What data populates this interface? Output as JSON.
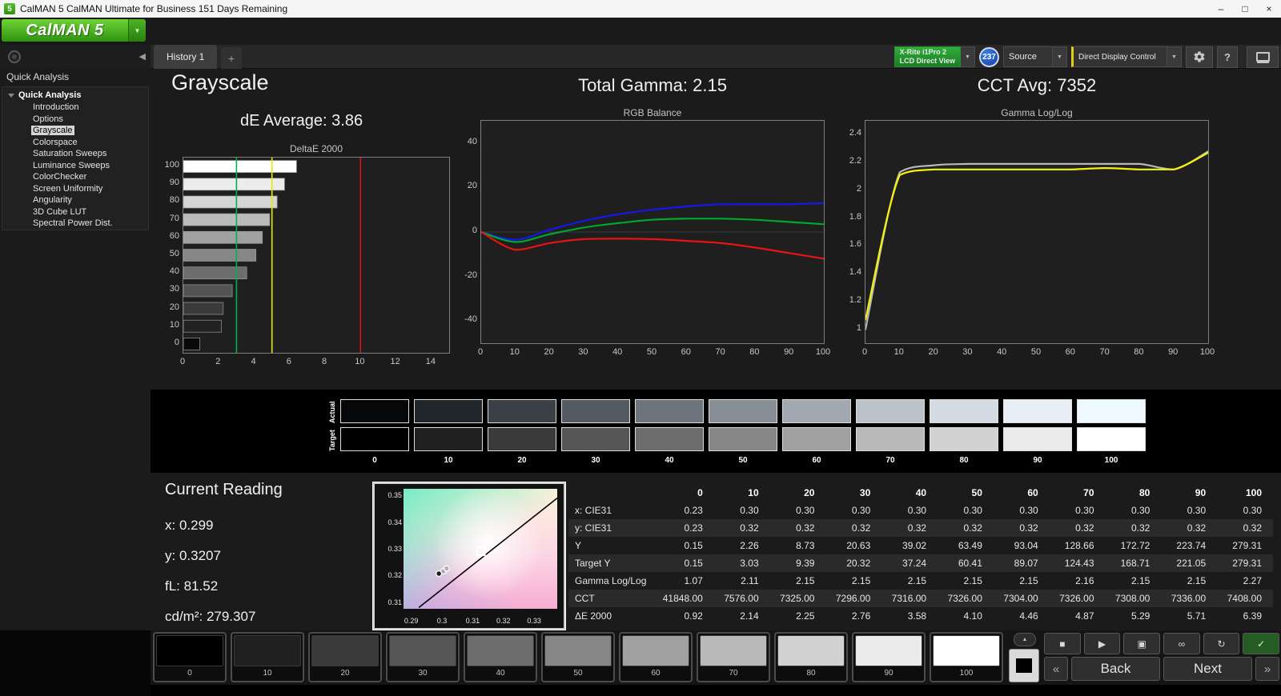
{
  "window": {
    "icon_text": "5",
    "title": "CalMAN 5 CalMAN Ultimate for Business 151 Days Remaining",
    "logo_text": "CalMAN 5"
  },
  "icons": {
    "dropdown": "▼",
    "collapse_left": "◀",
    "chevron_up": "▲",
    "back_chevrons": "«",
    "next_chevrons": "»",
    "help": "?",
    "add_tab": "+",
    "minimize": "–",
    "maximize": "□",
    "close": "×"
  },
  "toolbar": {
    "history_tab": "History 1",
    "meter_line1": "X-Rite i1Pro 2",
    "meter_line2": "LCD Direct View",
    "meter_badge": "237",
    "source_label": "Source",
    "display_control_label": "Direct Display Control"
  },
  "sidebar": {
    "header": "Quick Analysis",
    "tree_root": "Quick Analysis",
    "selected_item": "Grayscale",
    "items": [
      "Introduction",
      "Options",
      "Grayscale",
      "Colorspace",
      "Saturation Sweeps",
      "Luminance Sweeps",
      "ColorChecker",
      "Screen Uniformity",
      "Angularity",
      "3D Cube LUT",
      "Spectral Power Dist."
    ]
  },
  "header": {
    "title": "Grayscale",
    "de_average": "dE Average: 3.86",
    "total_gamma": "Total Gamma: 2.15",
    "cct_avg": "CCT Avg: 7352"
  },
  "chart_data": [
    {
      "id": "deltae",
      "type": "bar",
      "title": "DeltaE 2000",
      "orientation": "horizontal",
      "categories": [
        "100",
        "90",
        "80",
        "70",
        "60",
        "50",
        "40",
        "30",
        "20",
        "10",
        "0"
      ],
      "values": [
        6.39,
        5.71,
        5.29,
        4.87,
        4.46,
        4.1,
        3.58,
        2.76,
        2.25,
        2.14,
        0.92
      ],
      "bar_colors": [
        "#ffffff",
        "#ececec",
        "#d5d5d5",
        "#bbbbbb",
        "#a1a1a1",
        "#878787",
        "#6d6d6d",
        "#535353",
        "#3a3a3a",
        "#222222",
        "#0a0a0a"
      ],
      "xlim": [
        0,
        15
      ],
      "xticks": [
        0,
        2,
        4,
        6,
        8,
        10,
        12,
        14
      ],
      "reference_lines": [
        {
          "value": 3,
          "color": "#00b050"
        },
        {
          "value": 5,
          "color": "#e8e800"
        },
        {
          "value": 10,
          "color": "#e01010"
        }
      ]
    },
    {
      "id": "rgb",
      "type": "line",
      "title": "RGB Balance",
      "x": [
        0,
        10,
        20,
        30,
        40,
        50,
        60,
        70,
        80,
        90,
        100
      ],
      "ylim": [
        -50,
        50
      ],
      "yticks": [
        40,
        20,
        0,
        -20,
        -40
      ],
      "xticks": [
        0,
        10,
        20,
        30,
        40,
        50,
        60,
        70,
        80,
        90,
        100
      ],
      "zero_line": true,
      "series": [
        {
          "name": "Blue",
          "color": "#1616ee",
          "values": [
            0,
            -3.5,
            1,
            5,
            8,
            10,
            11.5,
            12.5,
            12.5,
            12.5,
            13
          ]
        },
        {
          "name": "Green",
          "color": "#00a82d",
          "values": [
            0,
            -4.5,
            -1,
            2,
            4,
            5.5,
            6,
            6,
            5.5,
            4.5,
            3.5
          ]
        },
        {
          "name": "Red",
          "color": "#e81414",
          "values": [
            0,
            -8,
            -5,
            -3.2,
            -3,
            -3.2,
            -4,
            -5,
            -7,
            -9.5,
            -12
          ]
        }
      ]
    },
    {
      "id": "gamma",
      "type": "line",
      "title": "Gamma Log/Log",
      "x": [
        0,
        10,
        20,
        30,
        40,
        50,
        60,
        70,
        80,
        90,
        100
      ],
      "ylim": [
        0.9,
        2.5
      ],
      "yticks": [
        2.4,
        2.2,
        2,
        1.8,
        1.6,
        1.4,
        1.2,
        1
      ],
      "xticks": [
        0,
        10,
        20,
        30,
        40,
        50,
        60,
        70,
        80,
        90,
        100
      ],
      "zero_line": false,
      "series": [
        {
          "name": "Target",
          "color": "#b8b8b8",
          "values": [
            1.0,
            2.13,
            2.18,
            2.19,
            2.19,
            2.19,
            2.19,
            2.19,
            2.19,
            2.15,
            2.28
          ]
        },
        {
          "name": "Measured",
          "color": "#f2f20a",
          "values": [
            1.07,
            2.11,
            2.15,
            2.15,
            2.15,
            2.15,
            2.15,
            2.16,
            2.15,
            2.15,
            2.27
          ]
        }
      ]
    },
    {
      "id": "cie",
      "type": "scatter",
      "title": "CIE Chart",
      "xlim": [
        0.2875,
        0.3375
      ],
      "ylim": [
        0.3075,
        0.3525
      ],
      "xticks": [
        0.29,
        0.3,
        0.31,
        0.32,
        0.33
      ],
      "yticks": [
        0.35,
        0.34,
        0.33,
        0.32,
        0.31
      ],
      "locus_line": [
        [
          0.2925,
          0.308
        ],
        [
          0.3375,
          0.349
        ]
      ],
      "target_point": {
        "x": 0.3127,
        "y": 0.329
      },
      "points": [
        {
          "x": 0.299,
          "y": 0.3207,
          "style": "filled"
        },
        {
          "x": 0.3005,
          "y": 0.3216,
          "style": "open"
        },
        {
          "x": 0.3015,
          "y": 0.3226,
          "style": "open"
        }
      ]
    }
  ],
  "swatches": {
    "row_labels": [
      "Actual",
      "Target"
    ],
    "levels": [
      "0",
      "10",
      "20",
      "30",
      "40",
      "50",
      "60",
      "70",
      "80",
      "90",
      "100"
    ],
    "actual_colors": [
      "#050708",
      "#21262b",
      "#3a4046",
      "#535a61",
      "#6d747b",
      "#878e95",
      "#a1a8af",
      "#bbc2c9",
      "#d4dbe2",
      "#e7eef5",
      "#eef8ff"
    ],
    "target_colors": [
      "#000000",
      "#202020",
      "#3a3a3a",
      "#555555",
      "#6d6d6d",
      "#868686",
      "#a0a0a0",
      "#b9b9b9",
      "#d2d2d2",
      "#ebebeb",
      "#ffffff"
    ]
  },
  "current_reading": {
    "title": "Current Reading",
    "x": "x: 0.299",
    "y": "y: 0.3207",
    "fl": "fL: 81.52",
    "cdm2": "cd/m²: 279.307"
  },
  "table": {
    "columns": [
      "",
      "0",
      "10",
      "20",
      "30",
      "40",
      "50",
      "60",
      "70",
      "80",
      "90",
      "100"
    ],
    "rows": [
      {
        "label": "x: CIE31",
        "values": [
          "0.23",
          "0.30",
          "0.30",
          "0.30",
          "0.30",
          "0.30",
          "0.30",
          "0.30",
          "0.30",
          "0.30",
          "0.30"
        ]
      },
      {
        "label": "y: CIE31",
        "values": [
          "0.23",
          "0.32",
          "0.32",
          "0.32",
          "0.32",
          "0.32",
          "0.32",
          "0.32",
          "0.32",
          "0.32",
          "0.32"
        ]
      },
      {
        "label": "Y",
        "values": [
          "0.15",
          "2.26",
          "8.73",
          "20.63",
          "39.02",
          "63.49",
          "93.04",
          "128.66",
          "172.72",
          "223.74",
          "279.31"
        ]
      },
      {
        "label": "Target Y",
        "values": [
          "0.15",
          "3.03",
          "9.39",
          "20.32",
          "37.24",
          "60.41",
          "89.07",
          "124.43",
          "168.71",
          "221.05",
          "279.31"
        ]
      },
      {
        "label": "Gamma Log/Log",
        "values": [
          "1.07",
          "2.11",
          "2.15",
          "2.15",
          "2.15",
          "2.15",
          "2.15",
          "2.16",
          "2.15",
          "2.15",
          "2.27"
        ]
      },
      {
        "label": "CCT",
        "values": [
          "41848.00",
          "7576.00",
          "7325.00",
          "7296.00",
          "7316.00",
          "7326.00",
          "7304.00",
          "7326.00",
          "7308.00",
          "7336.00",
          "7408.00"
        ]
      },
      {
        "label": "ΔE 2000",
        "values": [
          "0.92",
          "2.14",
          "2.25",
          "2.76",
          "3.58",
          "4.10",
          "4.46",
          "4.87",
          "5.29",
          "5.71",
          "6.39"
        ]
      }
    ]
  },
  "transport": {
    "icons": [
      {
        "name": "stop-icon",
        "glyph": "■"
      },
      {
        "name": "play-icon",
        "glyph": "▶"
      },
      {
        "name": "capture-icon",
        "glyph": "▣"
      },
      {
        "name": "continuous-icon",
        "glyph": "∞"
      },
      {
        "name": "loop-icon",
        "glyph": "↻"
      },
      {
        "name": "accept-icon",
        "glyph": "✓",
        "accent": true
      }
    ]
  },
  "bottom_bar": {
    "patch_levels": [
      "0",
      "10",
      "20",
      "30",
      "40",
      "50",
      "60",
      "70",
      "80",
      "90",
      "100"
    ],
    "patch_colors": [
      "#000000",
      "#202020",
      "#3a3a3a",
      "#555555",
      "#6d6d6d",
      "#868686",
      "#a0a0a0",
      "#b9b9b9",
      "#d2d2d2",
      "#ebebeb",
      "#ffffff"
    ],
    "back_label": "Back",
    "next_label": "Next"
  },
  "colors": {
    "accent_green": "#3fae2a",
    "badge_blue": "#1c55c0",
    "ddc_yellow": "#e3cf14",
    "limit_green": "#00b050",
    "limit_yellow": "#e8e800",
    "limit_red": "#e01010"
  }
}
